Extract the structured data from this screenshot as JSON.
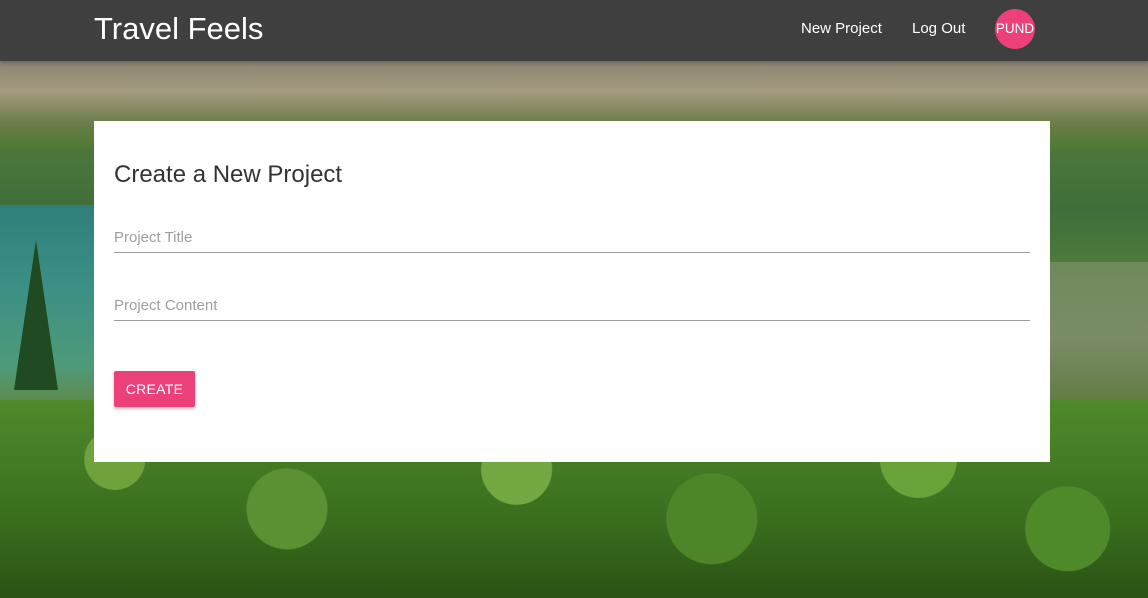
{
  "navbar": {
    "brand": "Travel Feels",
    "links": {
      "new_project": "New Project",
      "log_out": "Log Out"
    },
    "avatar_initials": "PUND",
    "avatar_color": "#ec407a",
    "background_color": "#3f3f3f"
  },
  "form": {
    "title": "Create a New Project",
    "project_title": {
      "placeholder": "Project Title",
      "value": ""
    },
    "project_content": {
      "placeholder": "Project Content",
      "value": ""
    },
    "submit_label": "CREATE",
    "accent_color": "#ec407a"
  }
}
